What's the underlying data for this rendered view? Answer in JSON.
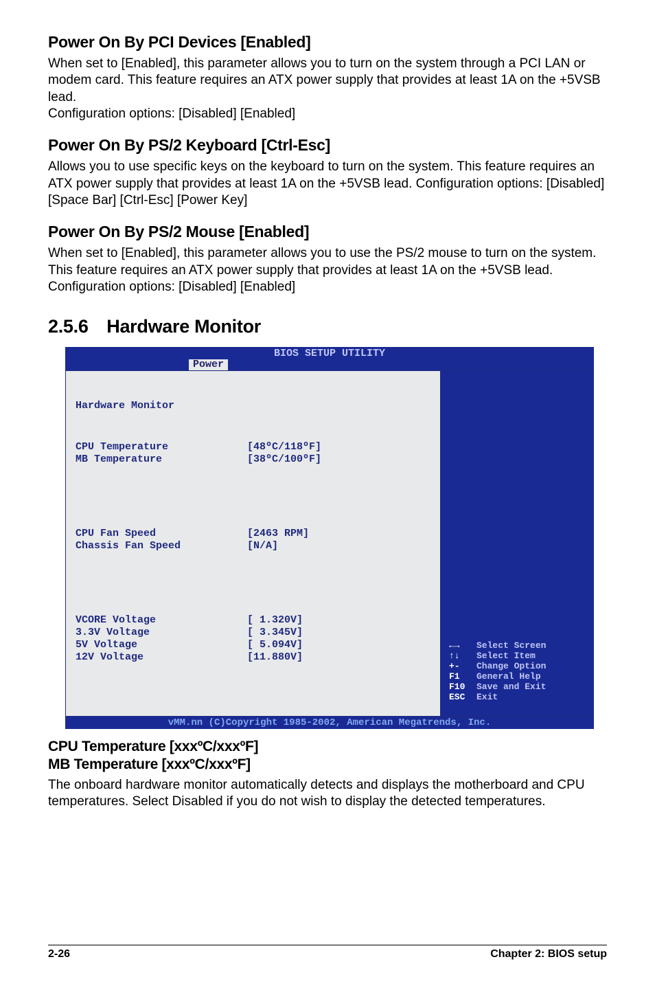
{
  "sections": {
    "pci": {
      "heading": "Power On By PCI Devices [Enabled]",
      "body": "When set to [Enabled], this parameter allows you to turn on the system through a PCI LAN or modem card. This feature requires an ATX power supply that provides at least 1A on the +5VSB lead.\nConfiguration options: [Disabled] [Enabled]"
    },
    "ps2kb": {
      "heading": "Power On By PS/2 Keyboard [Ctrl-Esc]",
      "body": "Allows you to use specific keys on the keyboard to turn on the system. This feature requires an ATX power supply that provides at least 1A on the +5VSB lead. Configuration options: [Disabled] [Space Bar] [Ctrl-Esc] [Power Key]"
    },
    "ps2mouse": {
      "heading": "Power On By PS/2 Mouse [Enabled]",
      "body": "When set to [Enabled], this parameter allows you to use the PS/2 mouse to turn on the system. This feature requires an ATX power supply that provides at least 1A on the +5VSB lead.\nConfiguration options: [Disabled] [Enabled]"
    },
    "hwmon": {
      "heading": "2.5.6 Hardware Monitor"
    },
    "temps": {
      "heading1": "CPU Temperature [xxxºC/xxxºF]",
      "heading2": "MB Temperature [xxxºC/xxxºF]",
      "body": "The onboard hardware monitor automatically detects and displays the motherboard and CPU temperatures. Select Disabled if you do not wish to display the detected temperatures."
    }
  },
  "bios": {
    "title": "BIOS SETUP UTILITY",
    "tab": "Power",
    "panel_title": "Hardware Monitor",
    "rows": [
      {
        "label": "CPU Temperature",
        "value": "[48ºC/118ºF]"
      },
      {
        "label": "MB Temperature",
        "value": "[38ºC/100ºF]"
      }
    ],
    "rows2": [
      {
        "label": "CPU Fan Speed",
        "value": "[2463 RPM]"
      },
      {
        "label": "Chassis Fan Speed",
        "value": "[N/A]"
      }
    ],
    "rows3": [
      {
        "label": "VCORE Voltage",
        "value": "[ 1.320V]"
      },
      {
        "label": "3.3V Voltage",
        "value": "[ 3.345V]"
      },
      {
        "label": "5V Voltage",
        "value": "[ 5.094V]"
      },
      {
        "label": "12V Voltage",
        "value": "[11.880V]"
      }
    ],
    "help": [
      {
        "key": "←→",
        "txt": "Select Screen"
      },
      {
        "key": "↑↓",
        "txt": "Select Item"
      },
      {
        "key": "+-",
        "txt": "Change Option"
      },
      {
        "key": "F1",
        "txt": "General Help"
      },
      {
        "key": "F10",
        "txt": "Save and Exit"
      },
      {
        "key": "ESC",
        "txt": "Exit"
      }
    ],
    "footer": "vMM.nn (C)Copyright 1985-2002, American Megatrends, Inc."
  },
  "footer": {
    "left": "2-26",
    "right": "Chapter 2: BIOS setup"
  }
}
